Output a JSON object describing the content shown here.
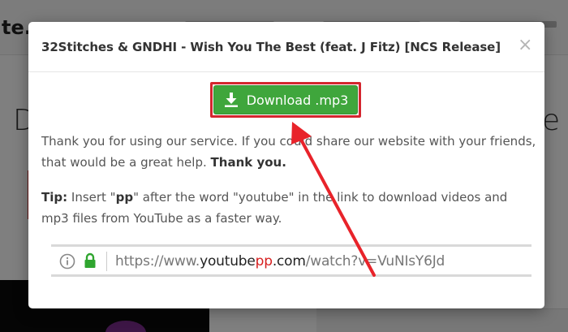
{
  "background": {
    "logo_text": "te.c",
    "left_char": "D",
    "right_char": "e"
  },
  "modal": {
    "title": "32Stitches & GNDHI - Wish You The Best (feat. J Fitz) [NCS Release]",
    "close_label": "×",
    "download_button": {
      "label": "Download .mp3",
      "icon": "download-icon",
      "color": "#3fa63c",
      "highlight_color": "#d4262f"
    },
    "message": {
      "text": "Thank you for using our service. If you could share our website with your friends, that would be a great help.",
      "bold": "Thank you."
    },
    "tip": {
      "label": "Tip:",
      "text_1": "Insert \"",
      "keyword": "pp",
      "text_2": "\" after the word \"youtube\" in the link to download videos and mp3 files from YouTube as a faster way."
    },
    "example_url": {
      "prefix": "https://www.",
      "domain": "youtube",
      "insert": "pp",
      "tld": ".com",
      "path": "/watch?v=VuNIsY6Jd",
      "icons": [
        "info-icon",
        "lock-icon"
      ]
    }
  },
  "annotation": {
    "arrow_color": "#e8232a"
  }
}
